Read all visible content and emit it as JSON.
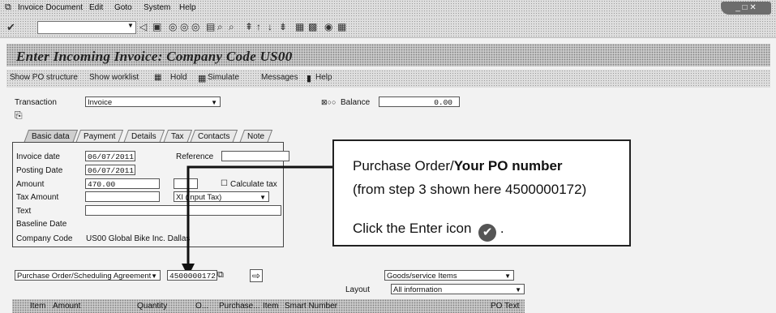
{
  "menubar": {
    "items": [
      "Invoice Document",
      "Edit",
      "Goto",
      "System",
      "Help"
    ]
  },
  "toolbar": {
    "command_value": "",
    "icons": [
      "enter-icon",
      "save-icon",
      "back-icon",
      "exit-icon",
      "cancel-icon",
      "print-icon",
      "find-icon",
      "find-next-icon",
      "first-page-icon",
      "previous-page-icon",
      "next-page-icon",
      "last-page-icon",
      "new-session-icon",
      "shortcut-icon",
      "help-icon",
      "layout-icon"
    ]
  },
  "title": "Enter Incoming Invoice: Company Code US00",
  "app_toolbar": {
    "show_po_structure": "Show PO structure",
    "show_worklist": "Show worklist",
    "hold": "Hold",
    "simulate": "Simulate",
    "messages": "Messages",
    "help": "Help"
  },
  "transaction": {
    "label": "Transaction",
    "value": "Invoice",
    "balance_label": "Balance",
    "balance_value": "0.00"
  },
  "tabs": [
    "Basic data",
    "Payment",
    "Details",
    "Tax",
    "Contacts",
    "Note"
  ],
  "basic_data": {
    "invoice_date_label": "Invoice date",
    "invoice_date": "06/07/2011",
    "reference_label": "Reference",
    "reference": "",
    "posting_date_label": "Posting Date",
    "posting_date": "06/07/2011",
    "amount_label": "Amount",
    "amount": "470.00",
    "currency": "",
    "calculate_tax_label": "Calculate tax",
    "tax_amount_label": "Tax Amount",
    "tax_amount": "",
    "tax_code": "XI (Input Tax)",
    "text_label": "Text",
    "text": "",
    "baseline_date_label": "Baseline Date",
    "company_code_label": "Company Code",
    "company_code": "US00 Global Bike Inc. Dallas"
  },
  "callout": {
    "line1_prefix": "Purchase Order/",
    "line1_bold": "Your PO number",
    "line2": "(from step 3 shown here 4500000172)",
    "line3": "Click the Enter icon",
    "line3_suffix": "."
  },
  "reference_row": {
    "ref_type": "Purchase Order/Scheduling Agreement",
    "po_number": "4500000172",
    "item_type": "Goods/service Items",
    "layout_label": "Layout",
    "layout_value": "All information"
  },
  "grid_columns": [
    "Item",
    "Amount",
    "Quantity",
    "O...",
    "Purchase...",
    "Item",
    "Smart Number",
    "PO Text"
  ]
}
